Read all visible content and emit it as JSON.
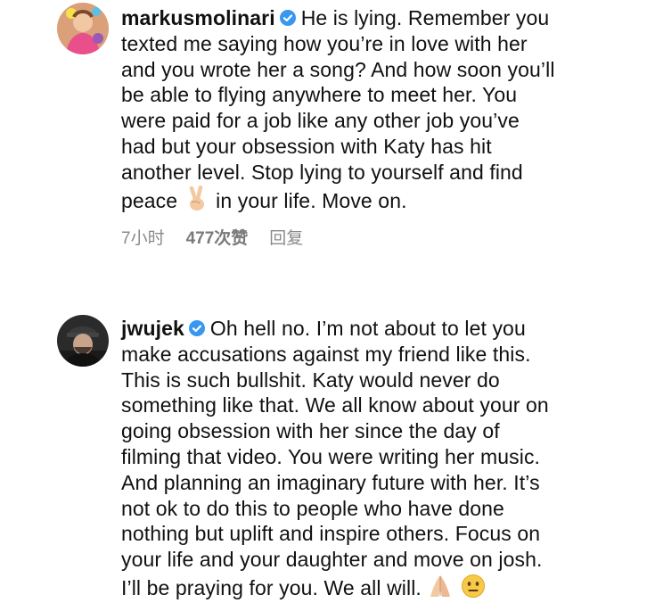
{
  "comments": [
    {
      "username": "markusmolinari",
      "verified": true,
      "avatar_icon": "avatar-photo-icon",
      "line1": "He is lying. Remember you",
      "line2": "texted me saying how you’re in love with her",
      "line3": "and you wrote her a song? And how soon you’ll",
      "line4": "be able to flying anywhere to meet her. You",
      "line5": "were paid for a job like any other job you’ve",
      "line6": "had but your obsession with Katy has hit",
      "line7": "another level. Stop lying to yourself and find",
      "line8a": "peace",
      "emoji1": "victory-hand-emoji",
      "line8b": "in your life. Move on.",
      "time": "7小时",
      "likes": "477次赞",
      "reply": "回复"
    },
    {
      "username": "jwujek",
      "verified": true,
      "avatar_icon": "avatar-photo-icon",
      "line1": "Oh hell no. I’m not about to let you",
      "line2": "make accusations against my friend like this.",
      "line3": "This is such bullshit. Katy would never do",
      "line4": "something like that.  We all know about your on",
      "line5": "going obsession with her since the day of",
      "line6": "filming that video.  You were writing her music.",
      "line7": "And planning an imaginary future with her. It’s",
      "line8": "not ok to do this to people who have done",
      "line9": "nothing but uplift and inspire others. Focus on",
      "line10": "your life and your daughter and move on josh.",
      "line11": "I’ll be praying for you. We all will.",
      "emoji1": "folded-hands-emoji",
      "emoji2": "neutral-face-emoji"
    }
  ],
  "colors": {
    "verified": "#3897f0",
    "meta": "#8a8a8a"
  }
}
